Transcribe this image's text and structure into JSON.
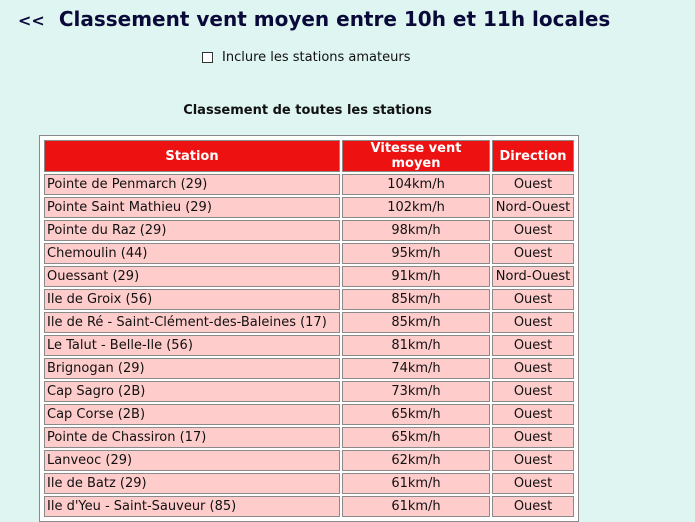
{
  "header": {
    "back_label": "<<",
    "title": "Classement vent moyen entre 10h et 11h locales"
  },
  "options": {
    "amateur_label": "Inclure les stations amateurs",
    "amateur_checked": false
  },
  "ranking": {
    "title": "Classement de toutes les stations",
    "columns": [
      "Station",
      "Vitesse vent moyen",
      "Direction"
    ],
    "rows": [
      {
        "station": "Pointe de Penmarch (29)",
        "speed": "104km/h",
        "direction": "Ouest"
      },
      {
        "station": "Pointe Saint Mathieu (29)",
        "speed": "102km/h",
        "direction": "Nord-Ouest"
      },
      {
        "station": "Pointe du Raz (29)",
        "speed": "98km/h",
        "direction": "Ouest"
      },
      {
        "station": "Chemoulin (44)",
        "speed": "95km/h",
        "direction": "Ouest"
      },
      {
        "station": "Ouessant (29)",
        "speed": "91km/h",
        "direction": "Nord-Ouest"
      },
      {
        "station": "Ile de Groix (56)",
        "speed": "85km/h",
        "direction": "Ouest"
      },
      {
        "station": "Ile de Ré - Saint-Clément-des-Baleines (17)",
        "speed": "85km/h",
        "direction": "Ouest"
      },
      {
        "station": "Le Talut - Belle-Ile (56)",
        "speed": "81km/h",
        "direction": "Ouest"
      },
      {
        "station": "Brignogan (29)",
        "speed": "74km/h",
        "direction": "Ouest"
      },
      {
        "station": "Cap Sagro (2B)",
        "speed": "73km/h",
        "direction": "Ouest"
      },
      {
        "station": "Cap Corse (2B)",
        "speed": "65km/h",
        "direction": "Ouest"
      },
      {
        "station": "Pointe de Chassiron (17)",
        "speed": "65km/h",
        "direction": "Ouest"
      },
      {
        "station": "Lanveoc (29)",
        "speed": "62km/h",
        "direction": "Ouest"
      },
      {
        "station": "Ile de Batz (29)",
        "speed": "61km/h",
        "direction": "Ouest"
      },
      {
        "station": "Ile d'Yeu - Saint-Sauveur (85)",
        "speed": "61km/h",
        "direction": "Ouest"
      }
    ]
  },
  "colors": {
    "background": "#dff5f1",
    "header_cell": "#ee1111",
    "row_cell": "#ffcccc",
    "title_text": "#0a0a3a"
  }
}
